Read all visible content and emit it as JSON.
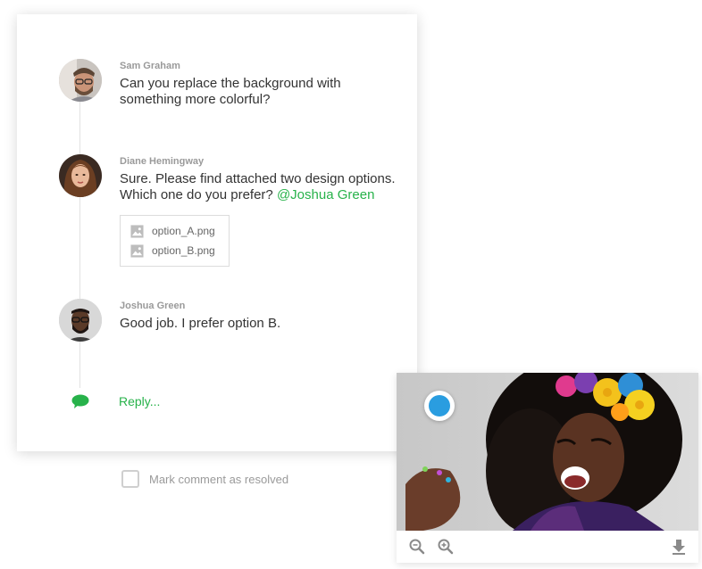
{
  "comments": [
    {
      "author": "Sam Graham",
      "text_line1": "Can you replace the background with",
      "text_line2": "something more colorful?",
      "avatar_icon": "avatar-man-beard-glasses"
    },
    {
      "author": "Diane Hemingway",
      "text_line1": "Sure. Please find attached two design options.",
      "text_line2": "Which one do you prefer?",
      "mention": "@Joshua Green",
      "avatar_icon": "avatar-woman",
      "attachments": [
        "option_A.png",
        "option_B.png"
      ]
    },
    {
      "author": "Joshua Green",
      "text_line1": "Good job. I prefer option B.",
      "avatar_icon": "avatar-man-glasses-beard"
    }
  ],
  "reply": {
    "label": "Reply...",
    "icon": "chat-bubble-icon"
  },
  "resolve": {
    "label": "Mark comment as resolved",
    "checked": false
  },
  "image_viewer": {
    "tools": [
      "zoom-out-icon",
      "zoom-in-icon",
      "download-icon"
    ]
  },
  "colors": {
    "accent_green": "#27b24a",
    "marker_blue": "#2a9de0",
    "muted_text": "#9a9a9a"
  }
}
